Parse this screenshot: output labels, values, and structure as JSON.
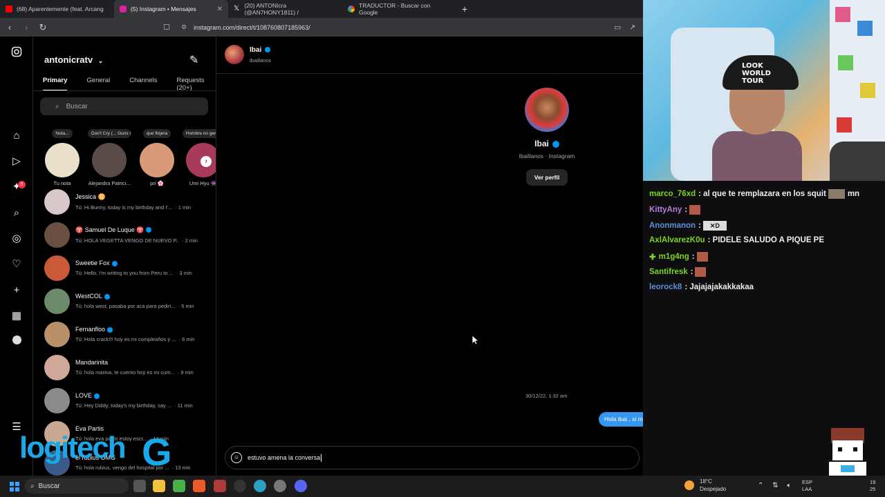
{
  "browser": {
    "tabs": [
      {
        "label": "(68) Aparentemente (feat. Arcang",
        "icon": "youtube-icon",
        "color": "#ff0000"
      },
      {
        "label": "(5) Instagram • Mensajes",
        "icon": "instagram-icon",
        "color": "#d6249f"
      },
      {
        "label": "(20) ANTONIcra (@AN7HONY1811) /",
        "icon": "x-icon",
        "color": "#ffffff"
      },
      {
        "label": "TRADUCTOR - Buscar con Google",
        "icon": "google-icon",
        "color": "#4285f4"
      }
    ],
    "url": "instagram.com/direct/t/108760807185963/"
  },
  "instagram": {
    "username": "antonicratv",
    "tabs": [
      "Primary",
      "General",
      "Channels",
      "Requests (20+)"
    ],
    "search_placeholder": "Buscar",
    "notification_badge": "5",
    "notes": [
      {
        "bubble": "Nota...",
        "name": "Tu nota"
      },
      {
        "bubble": "Don't Cry (... Guns N' Roses",
        "name": "Alejandra Patrici..."
      },
      {
        "bubble": "que flojera",
        "name": "pri 🌸"
      },
      {
        "bubble": "Hombre no gente",
        "name": "Umi Hyu 👾"
      }
    ],
    "conversations": [
      {
        "name": "Jessica ♊",
        "verified": false,
        "message": "Tú: Hi Bunny, today is my birthday and I'...",
        "time": "· 1 min"
      },
      {
        "name": "♈ Samuel De Luque ♈",
        "verified": true,
        "message": "Tú: HOLA VEGETTA VENGO DE NUEVO P...",
        "time": "· 2 min"
      },
      {
        "name": "Sweetie Fox",
        "verified": true,
        "message": "Tú: Hello, I'm writing to you from Peru to ...",
        "time": "· 3 min"
      },
      {
        "name": "WestCOL",
        "verified": true,
        "message": "Tú: hola west, pasaba por aca para pedirt...",
        "time": "· 5 min"
      },
      {
        "name": "Fernanfloo",
        "verified": true,
        "message": "Tú: Hola crack!!! hoy es mi cumpleaños y ...",
        "time": "· 6 min"
      },
      {
        "name": "Mandarinita",
        "verified": false,
        "message": "Tú: hola marina, te cuento hoy es mi cum...",
        "time": "· 9 min"
      },
      {
        "name": "LOVE",
        "verified": true,
        "message": "Tú: Hey Diddy, today's my birthday, say ...",
        "time": "· 11 min"
      },
      {
        "name": "Eva Partis",
        "verified": false,
        "message": "Tú: hola eva partis estoy escr...",
        "time": "· 12 min"
      },
      {
        "name": "el rubius OMG",
        "verified": false,
        "message": "Tú: hola rubius, vengo del hospital por ...",
        "time": "· 13 min"
      }
    ],
    "chat": {
      "name": "Ibai",
      "handle": "ibaillanos",
      "profile_meta": "ibaillanos · Instagram",
      "view_profile": "Ver perfil",
      "timestamp": "30/12/22, 1:32 am",
      "outgoing_message": "Hola ibai , si me invitas a la velada puedo ir yo contra todos al mismo tiempo? saludos!!",
      "composer_text": "estuvo amena la conversa"
    }
  },
  "stream_overlay": {
    "cap_text": "LOOK WORLD TOUR",
    "chat": [
      {
        "user": "marco_76xd",
        "color": "#7ed321",
        "text": ": al que te remplazara en los squit",
        "suffix": "mn"
      },
      {
        "user": "KittyAny",
        "color": "#b77ee0",
        "text": ":",
        "suffix": ""
      },
      {
        "user": "Anonmanon",
        "color": "#5b8fd8",
        "text": ":",
        "suffix": ""
      },
      {
        "user": "AxlAlvarezK0u",
        "color": "#7ed321",
        "text": ": PIDELE SALUDO A PIQUE PE",
        "suffix": ""
      },
      {
        "user": "m1g4ng",
        "color": "#7ed321",
        "text": ":",
        "suffix": ""
      },
      {
        "user": "Santifresk",
        "color": "#7ed321",
        "text": ":",
        "suffix": ""
      },
      {
        "user": "leorock8",
        "color": "#5b8fd8",
        "text": ": Jajajajakakkakaa",
        "suffix": ""
      }
    ],
    "brand": "logitech",
    "brand_g": "G"
  },
  "taskbar": {
    "search": "Buscar",
    "weather_temp": "18°C",
    "weather_desc": "Despejado",
    "lang_top": "ESP",
    "lang_bottom": "LAA",
    "clock_top": "19",
    "clock_bottom": "25"
  }
}
